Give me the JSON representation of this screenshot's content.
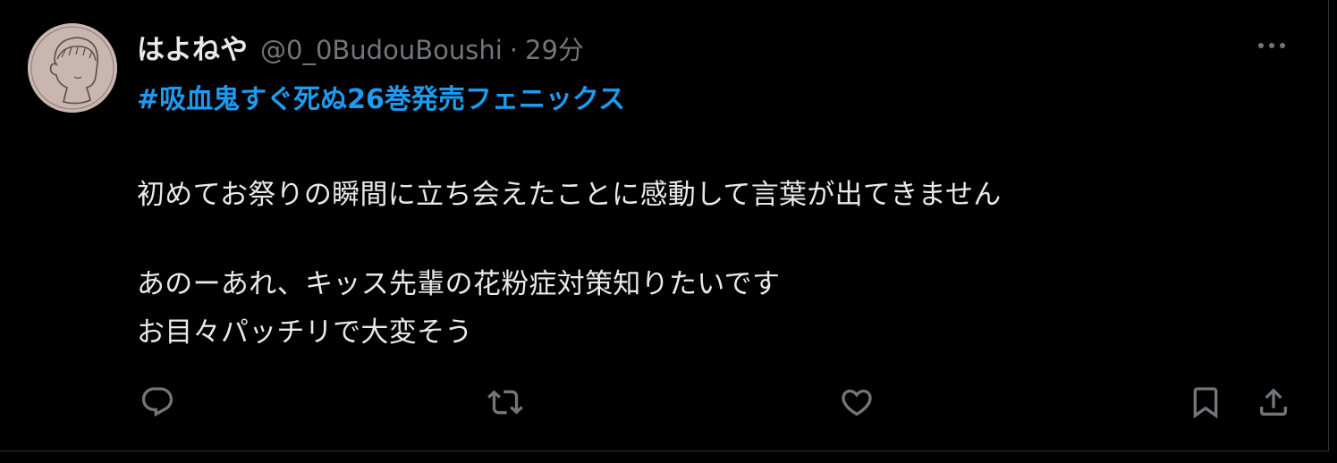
{
  "user": {
    "display_name": "はよねや",
    "handle": "@0_0BudouBoushi",
    "separator": "·",
    "time": "29分"
  },
  "tweet": {
    "hashtag": "#吸血鬼すぐ死ぬ26巻発売フェニックス",
    "lines": [
      "初めてお祭りの瞬間に立ち会えたことに感動して言葉が出てきません",
      "あのーあれ、キッス先輩の花粉症対策知りたいです",
      "お目々パッチリで大変そう"
    ]
  },
  "icons": {
    "more": "more-dots-icon",
    "reply": "reply-icon",
    "retweet": "retweet-icon",
    "like": "heart-icon",
    "bookmark": "bookmark-icon",
    "share": "share-icon"
  },
  "colors": {
    "background": "#000000",
    "text": "#e7e9ea",
    "secondary": "#71767b",
    "link": "#1d9bf0",
    "border": "#2f3336"
  }
}
